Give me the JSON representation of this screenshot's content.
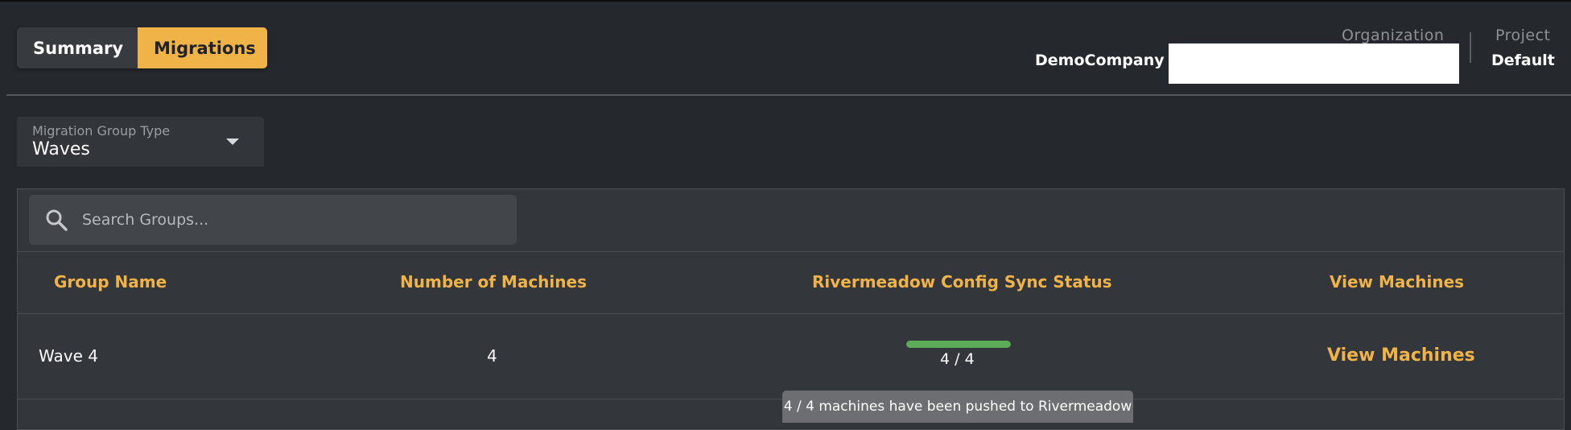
{
  "tabs": [
    {
      "label": "Summary",
      "active": false
    },
    {
      "label": "Migrations",
      "active": true
    }
  ],
  "header": {
    "organization_label": "Organization",
    "organization_name": "DemoCompany",
    "project_label": "Project",
    "project_name": "Default"
  },
  "group_type": {
    "label": "Migration Group Type",
    "value": "Waves"
  },
  "search": {
    "placeholder": "Search Groups..."
  },
  "table": {
    "columns": [
      "Group Name",
      "Number of Machines",
      "Rivermeadow Config Sync Status",
      "View Machines"
    ],
    "rows": [
      {
        "group_name": "Wave 4",
        "machines": "4",
        "sync_status": "4 / 4",
        "sync_progress": 1.0,
        "view_link": "View Machines"
      }
    ]
  },
  "tooltip": "4 / 4 machines have been pushed to Rivermeadow",
  "colors": {
    "accent": "#f0b347",
    "progress": "#5cab58",
    "background": "#25282c"
  },
  "icons": {
    "search": "search-icon",
    "dropdown": "caret-down-icon"
  }
}
